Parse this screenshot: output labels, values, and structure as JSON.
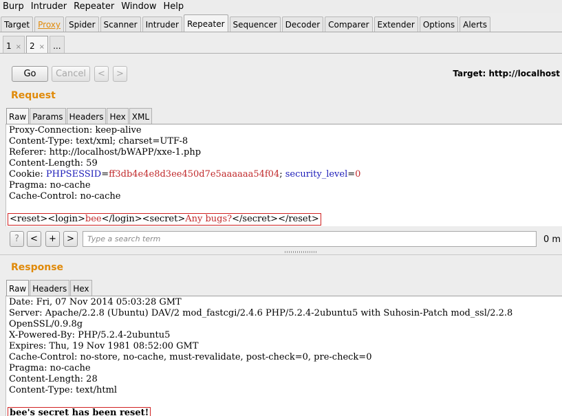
{
  "menu": [
    "Burp",
    "Intruder",
    "Repeater",
    "Window",
    "Help"
  ],
  "main_tabs": [
    "Target",
    "Proxy",
    "Spider",
    "Scanner",
    "Intruder",
    "Repeater",
    "Sequencer",
    "Decoder",
    "Comparer",
    "Extender",
    "Options",
    "Alerts"
  ],
  "active_main_tab": "Repeater",
  "sub_tabs": {
    "tab1": "1",
    "tab2": "2",
    "close": "×",
    "new": "..."
  },
  "toolbar": {
    "go": "Go",
    "cancel": "Cancel",
    "back": "<",
    "forward": ">",
    "target": "Target: http://localhost"
  },
  "request": {
    "title": "Request",
    "tabs": [
      "Raw",
      "Params",
      "Headers",
      "Hex",
      "XML"
    ],
    "lines": [
      "Proxy-Connection: keep-alive",
      "Content-Type: text/xml; charset=UTF-8",
      "Referer: http://localhost/bWAPP/xxe-1.php",
      "Content-Length: 59"
    ],
    "cookie": {
      "prefix": "Cookie: ",
      "name1": "PHPSESSID",
      "eq1": "=",
      "val1": "ff3db4e4e8d3ee450d7e5aaaaaa54f04",
      "sep": "; ",
      "name2": "security_level",
      "eq2": "=",
      "val2": "0"
    },
    "lines2": [
      "Pragma: no-cache",
      "Cache-Control: no-cache"
    ],
    "body": {
      "reset_open": "<reset>",
      "login_open": "<login>",
      "login": "bee",
      "login_close": "</login>",
      "secret_open": "<secret>",
      "secret": "Any bugs?",
      "secret_close": "</secret>",
      "reset_close": "</reset>"
    }
  },
  "search": {
    "help": "?",
    "prev": "<",
    "add": "+",
    "next": ">",
    "placeholder": "Type a search term",
    "matches": "0 m"
  },
  "response": {
    "title": "Response",
    "tabs": [
      "Raw",
      "Headers",
      "Hex"
    ],
    "lines": [
      "Date: Fri, 07 Nov 2014 05:03:28 GMT",
      "Server: Apache/2.2.8 (Ubuntu) DAV/2 mod_fastcgi/2.4.6 PHP/5.2.4-2ubuntu5 with Suhosin-Patch mod_ssl/2.2.8",
      "OpenSSL/0.9.8g",
      "X-Powered-By: PHP/5.2.4-2ubuntu5",
      "Expires: Thu, 19 Nov 1981 08:52:00 GMT",
      "Cache-Control: no-store, no-cache, must-revalidate, post-check=0, pre-check=0",
      "Pragma: no-cache",
      "Content-Length: 28",
      "Content-Type: text/html"
    ],
    "body": "bee's secret has been reset!"
  },
  "colors": {
    "accent": "#e08a0a",
    "highlight_border": "#d02020",
    "cookie_name": "#1a1ab8",
    "cookie_value": "#c0282a"
  }
}
